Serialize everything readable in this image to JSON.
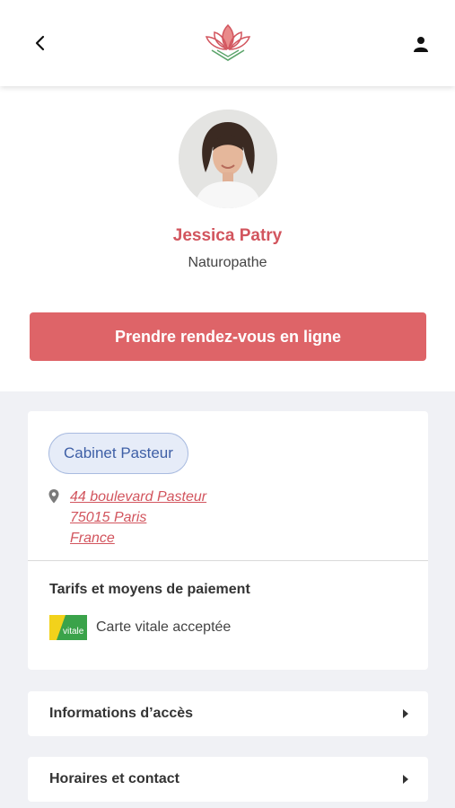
{
  "header": {
    "back_icon": "chevron-left-icon",
    "logo_icon": "lotus-logo",
    "account_icon": "user-icon"
  },
  "profile": {
    "name": "Jessica Patry",
    "specialty": "Naturopathe",
    "book_label": "Prendre rendez-vous en ligne"
  },
  "location": {
    "cabinet_label": "Cabinet Pasteur",
    "address_lines": [
      "44 boulevard Pasteur",
      "75015 Paris",
      "France"
    ]
  },
  "payment": {
    "title": "Tarifs et moyens de paiement",
    "vitale_badge_text": "vitale",
    "vitale_label": "Carte vitale acceptée"
  },
  "sections": [
    {
      "label": "Informations d’accès"
    },
    {
      "label": "Horaires et contact"
    }
  ],
  "colors": {
    "brand": "#de6468",
    "name": "#d2555e",
    "pill_bg": "#e6ecf8",
    "pill_text": "#3e5fa6",
    "background": "#f0f1f5"
  }
}
